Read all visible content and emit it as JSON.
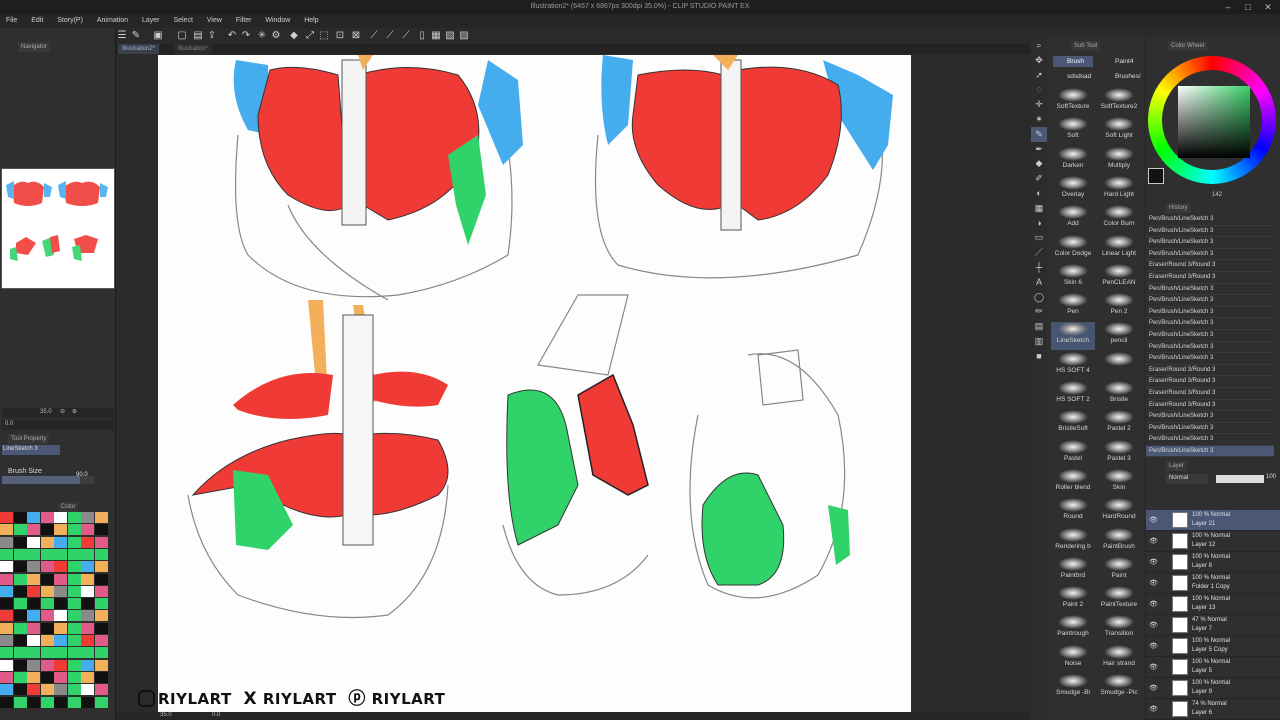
{
  "window": {
    "title": "Illustration2* (6467 x 6867px 300dpi 35.0%) - CLIP STUDIO PAINT EX",
    "minimize": "–",
    "maximize": "□",
    "close": "✕"
  },
  "menu": [
    "File",
    "Edit",
    "Story(P)",
    "Animation",
    "Layer",
    "Select",
    "View",
    "Filter",
    "Window",
    "Help"
  ],
  "tabs": [
    "Illustration2*",
    "Illustration*"
  ],
  "left_panel": {
    "navigator_tab": "Navigator",
    "zoom_value": "35.0",
    "rotate_value": "0.0",
    "tool_property_tab": "Tool Property",
    "tool_name": "LineSketch 3",
    "brush_size_label": "Brush Size",
    "brush_size_value": "90.0",
    "color_set_tab": "Color"
  },
  "status_bar": {
    "zoom": "35.0",
    "angle": "0.0"
  },
  "watermark": {
    "instagram": "RIYLART",
    "x": "RIYLART",
    "pinterest": "RIYLART"
  },
  "sub_tool": {
    "tab": "Sub Tool",
    "tabs": [
      "Brush",
      "Paint4",
      "sdsdsad",
      "Brushes/"
    ],
    "brushes": [
      "SoftTexture",
      "SoftTexture2",
      "Soft",
      "Soft Light",
      "Darken",
      "Multiply",
      "Overlay",
      "Hard Light",
      "Add",
      "Color Burn",
      "Color Dodge",
      "Linear Light",
      "Skin 6",
      "PenCLEAN",
      "Pen",
      "Pen 2",
      "LineSketch",
      "pencil",
      "HS SOFT 4",
      "",
      "HS SOFT 2",
      "Bristle",
      "BristleSoft",
      "Pastel 2",
      "Pastel",
      "Pastel 3",
      "Roller blend",
      "Skin",
      "Round",
      "HardRound",
      "Rendering b",
      "PaintBrush",
      "Paintbrd",
      "Paint",
      "Paint 2",
      "PaintTexture",
      "Paintrough",
      "Transition",
      "Noise",
      "Hair strand",
      "Smudge -Bl",
      "Smudge -Pic"
    ]
  },
  "color_wheel": {
    "tab": "Color Wheel",
    "value_readout": "142"
  },
  "history": {
    "tab": "History",
    "items": [
      "Pen/Brush/LineSketch 3",
      "Pen/Brush/LineSketch 3",
      "Pen/Brush/LineSketch 3",
      "Pen/Brush/LineSketch 3",
      "Eraser/Round 3/Round 3",
      "Eraser/Round 3/Round 3",
      "Pen/Brush/LineSketch 3",
      "Pen/Brush/LineSketch 3",
      "Pen/Brush/LineSketch 3",
      "Pen/Brush/LineSketch 3",
      "Pen/Brush/LineSketch 3",
      "Pen/Brush/LineSketch 3",
      "Pen/Brush/LineSketch 3",
      "Eraser/Round 3/Round 3",
      "Eraser/Round 3/Round 3",
      "Eraser/Round 3/Round 3",
      "Eraser/Round 3/Round 3",
      "Pen/Brush/LineSketch 3",
      "Pen/Brush/LineSketch 3",
      "Pen/Brush/LineSketch 3",
      "Pen/Brush/LineSketch 3"
    ]
  },
  "layer_panel": {
    "tab": "Layer",
    "blend_mode": "Normal",
    "opacity": "100",
    "layers": [
      {
        "line1": "100 % Normal",
        "line2": "Layer 21"
      },
      {
        "line1": "100 % Normal",
        "line2": "Layer 12"
      },
      {
        "line1": "100 % Normal",
        "line2": "Layer 8"
      },
      {
        "line1": "100 % Normal",
        "line2": "Folder 1 Copy"
      },
      {
        "line1": "100 % Normal",
        "line2": "Layer 13"
      },
      {
        "line1": "47 % Normal",
        "line2": "Layer 7"
      },
      {
        "line1": "100 % Normal",
        "line2": "Layer 5 Copy"
      },
      {
        "line1": "100 % Normal",
        "line2": "Layer 5"
      },
      {
        "line1": "100 % Normal",
        "line2": "Layer 9"
      },
      {
        "line1": "74 % Normal",
        "line2": "Layer 6"
      }
    ]
  },
  "colors": {
    "muscle_red": "#f03a36",
    "serratus_green": "#2fd36a",
    "deltoid_blue": "#45acee",
    "trapezius_orange": "#f2b05a",
    "selection_blue": "#4a5876"
  }
}
